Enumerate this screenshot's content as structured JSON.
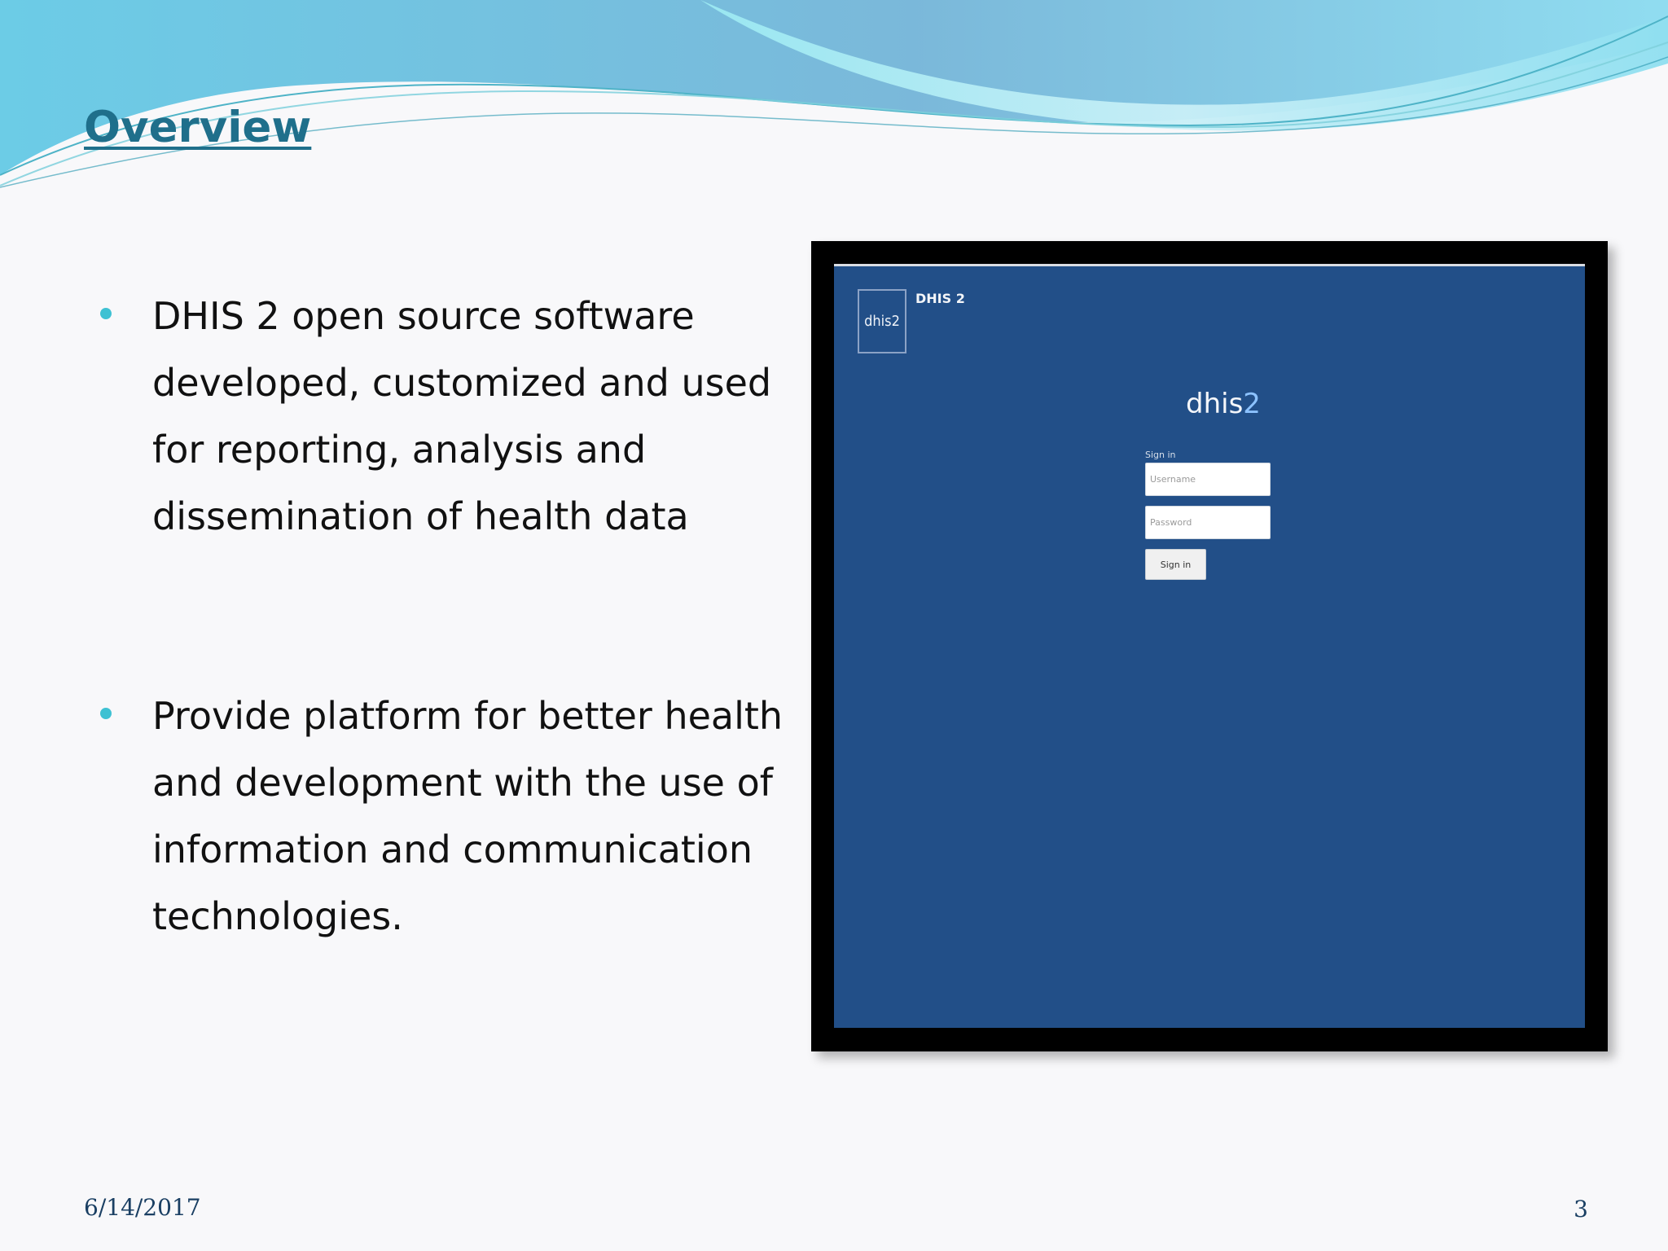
{
  "slide": {
    "title": "Overview",
    "bullets": [
      "DHIS 2 open source software developed, customized and used for reporting, analysis and dissemination of health data",
      "Provide platform for better health and development with the use of information and communication technologies."
    ],
    "footer": {
      "date": "6/14/2017",
      "page_number": "3"
    }
  },
  "embedded_screenshot": {
    "logo_text": "dhis2",
    "app_name": "DHIS 2",
    "center_logo_primary": "dhis",
    "center_logo_secondary": "2",
    "signin_label": "Sign in",
    "username_placeholder": "Username",
    "password_placeholder": "Password",
    "signin_button": "Sign in"
  },
  "colors": {
    "title": "#1f6f8b",
    "bullet": "#3ec1d3",
    "screenshot_background": "#224f88"
  }
}
